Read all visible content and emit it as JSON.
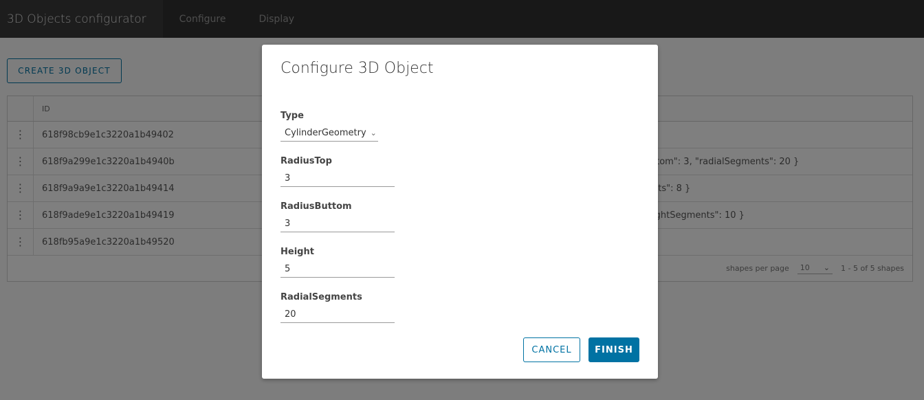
{
  "header": {
    "brand": "3D Objects configurator",
    "nav": [
      "Configure",
      "Display"
    ]
  },
  "page": {
    "create_button": "CREATE 3D OBJECT",
    "grid": {
      "column_id": "ID",
      "rows": [
        {
          "id": "618f98cb9e1c3220a1b49402",
          "extra": ""
        },
        {
          "id": "618f9a299e1c3220a1b4940b",
          "extra": "ttom\": 3, \"radialSegments\": 20 }"
        },
        {
          "id": "618f9a9a9e1c3220a1b49414",
          "extra": "nts\": 8 }"
        },
        {
          "id": "618f9ade9e1c3220a1b49419",
          "extra": "ightSegments\": 10 }"
        },
        {
          "id": "618fb95a9e1c3220a1b49520",
          "extra": ""
        }
      ],
      "footer": {
        "per_page_label": "shapes per page",
        "per_page_value": "10",
        "range": "1 - 5 of 5 shapes"
      }
    }
  },
  "modal": {
    "title": "Configure 3D Object",
    "type_label": "Type",
    "type_value": "CylinderGeometry",
    "fields": [
      {
        "label": "RadiusTop",
        "value": "3"
      },
      {
        "label": "RadiusButtom",
        "value": "3"
      },
      {
        "label": "Height",
        "value": "5"
      },
      {
        "label": "RadialSegments",
        "value": "20"
      }
    ],
    "cancel": "CANCEL",
    "finish": "FINISH"
  },
  "colors": {
    "accent": "#0072a3",
    "header": "#313131"
  }
}
